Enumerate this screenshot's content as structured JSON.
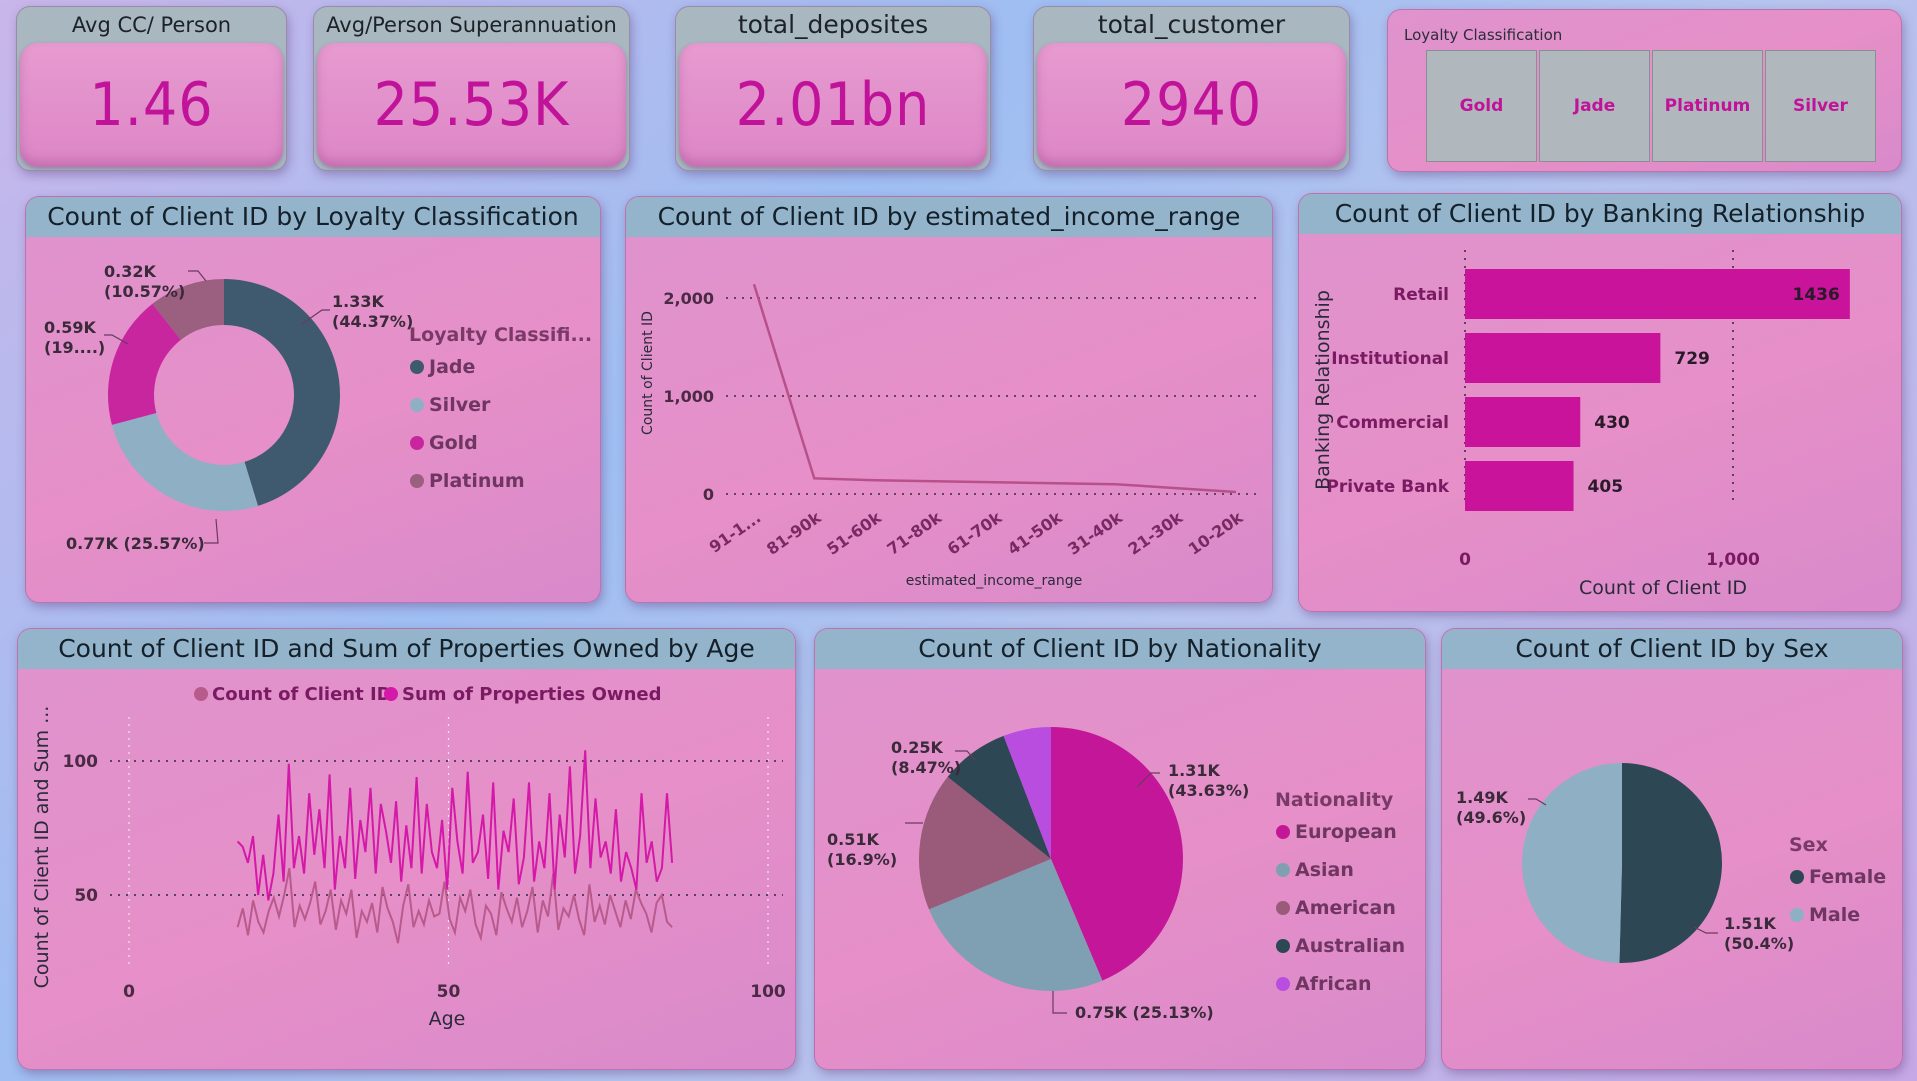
{
  "kpis": [
    {
      "title": "Avg CC/ Person",
      "value": "1.46"
    },
    {
      "title": "Avg/Person Superannuation",
      "value": "25.53K"
    },
    {
      "title": "total_deposites",
      "value": "2.01bn"
    },
    {
      "title": "total_customer",
      "value": "2940"
    }
  ],
  "slicer": {
    "title": "Loyalty Classification",
    "options": [
      "Gold",
      "Jade",
      "Platinum",
      "Silver"
    ]
  },
  "colors": {
    "jade": "#3f5a6e",
    "silver": "#8fb0c4",
    "gold": "#c8269f",
    "platinum": "#9b5f80",
    "european": "#c41699",
    "asian": "#7fa0b2",
    "american": "#9a5a7a",
    "australian": "#2d4755",
    "african": "#b84de0",
    "bar": "#c8139a",
    "line_count": "#b95a8c",
    "line_props": "#d419a8"
  },
  "chart_data": [
    {
      "id": "loyalty",
      "type": "pie",
      "title": "Count of Client ID by Loyalty Classification",
      "legend_title": "Loyalty Classifi...",
      "legend_position": "right",
      "donut": true,
      "categories": [
        "Jade",
        "Silver",
        "Gold",
        "Platinum"
      ],
      "values": [
        1331,
        752,
        546,
        311
      ],
      "data_labels": [
        "1.33K\n(44.37%)",
        "0.77K (25.57%)",
        "0.59K\n(19....)",
        "0.32K\n(10.57%)"
      ]
    },
    {
      "id": "income",
      "type": "line",
      "title": "Count of Client ID by estimated_income_range",
      "xlabel": "estimated_income_range",
      "ylabel": "Count of Client ID",
      "categories": [
        "91-1...",
        "81-90k",
        "51-60k",
        "71-80k",
        "61-70k",
        "41-50k",
        "31-40k",
        "21-30k",
        "10-20k"
      ],
      "values": [
        2140,
        160,
        140,
        130,
        120,
        110,
        100,
        60,
        20
      ],
      "yticks": [
        "2,000",
        "1,000",
        "0"
      ],
      "ylim": [
        0,
        2000
      ],
      "grid": true
    },
    {
      "id": "banking",
      "type": "bar",
      "orientation": "horizontal",
      "title": "Count of Client ID by Banking Relationship",
      "xlabel": "Count of Client ID",
      "ylabel": "Banking Relationship",
      "categories": [
        "Retail",
        "Institutional",
        "Commercial",
        "Private Bank"
      ],
      "values": [
        1436,
        729,
        430,
        405
      ],
      "xticks": [
        "0",
        "1,000"
      ],
      "xlim": [
        0,
        1500
      ]
    },
    {
      "id": "age",
      "type": "line",
      "title": "Count of Client ID and Sum of Properties Owned by Age",
      "xlabel": "Age",
      "ylabel": "Count of Client ID and Sum ...",
      "legend_position": "top",
      "xlim": [
        0,
        100
      ],
      "ylim": [
        0,
        120
      ],
      "xticks": [
        "0",
        "50",
        "100"
      ],
      "yticks": [
        "100",
        "50"
      ],
      "x_start": 17,
      "x_end": 85,
      "series": [
        {
          "name": "Count of Client ID",
          "values": [
            38,
            45,
            35,
            48,
            40,
            36,
            44,
            49,
            42,
            50,
            60,
            38,
            46,
            41,
            47,
            55,
            39,
            44,
            52,
            37,
            48,
            43,
            52,
            34,
            44,
            40,
            47,
            36,
            53,
            45,
            40,
            32,
            46,
            54,
            38,
            44,
            39,
            48,
            42,
            43,
            55,
            41,
            36,
            49,
            44,
            52,
            39,
            34,
            46,
            43,
            35,
            51,
            45,
            40,
            49,
            38,
            44,
            53,
            36,
            48,
            42,
            58,
            37,
            45,
            42,
            50,
            41,
            35,
            54,
            40,
            46,
            39,
            50,
            44,
            38,
            48,
            41,
            52,
            47,
            43,
            36,
            47,
            50,
            40,
            38
          ]
        },
        {
          "name": "Sum of Properties Owned",
          "values": [
            70,
            68,
            62,
            72,
            50,
            65,
            48,
            58,
            80,
            55,
            99,
            60,
            72,
            58,
            88,
            65,
            82,
            60,
            95,
            52,
            72,
            60,
            90,
            56,
            78,
            66,
            90,
            58,
            84,
            74,
            62,
            85,
            55,
            76,
            60,
            94,
            58,
            84,
            66,
            60,
            78,
            52,
            90,
            70,
            58,
            96,
            62,
            66,
            80,
            56,
            92,
            52,
            74,
            66,
            86,
            54,
            64,
            92,
            55,
            70,
            60,
            88,
            52,
            80,
            64,
            98,
            58,
            72,
            104,
            60,
            86,
            64,
            70,
            58,
            82,
            55,
            66,
            60,
            52,
            88,
            62,
            70,
            55,
            60,
            88,
            62
          ]
        }
      ]
    },
    {
      "id": "nationality",
      "type": "pie",
      "title": "Count of Client ID by Nationality",
      "legend_title": "Nationality",
      "legend_position": "right",
      "categories": [
        "European",
        "Asian",
        "American",
        "Australian",
        "African"
      ],
      "values": [
        1283,
        739,
        497,
        249,
        172
      ],
      "data_labels": [
        "1.31K\n(43.63%)",
        "0.75K (25.13%)",
        "0.51K\n(16.9%)",
        "0.25K\n(8.47%)",
        ""
      ]
    },
    {
      "id": "sex",
      "type": "pie",
      "title": "Count of Client ID by Sex",
      "legend_title": "Sex",
      "legend_position": "right",
      "categories": [
        "Female",
        "Male"
      ],
      "values": [
        1482,
        1458
      ],
      "data_labels": [
        "1.51K\n(50.4%)",
        "1.49K\n(49.6%)"
      ]
    }
  ]
}
